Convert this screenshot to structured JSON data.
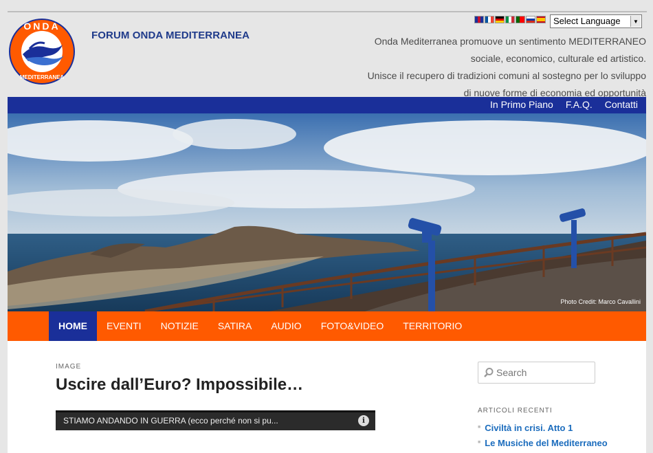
{
  "header": {
    "site_title": "FORUM ONDA MEDITERRANEA",
    "logo_text_top": "ONDA",
    "logo_text_bottom": "MEDITERRANEA",
    "language_select": "Select Language",
    "tagline_lines": [
      "Onda Mediterranea promuove un sentimento MEDITERRANEO",
      "sociale, economico, culturale ed artistico.",
      "Unisce il recupero di tradizioni comuni al sostegno per lo sviluppo",
      "di nuove forme di economia ed opportunità"
    ]
  },
  "top_nav": [
    "In Primo Piano",
    "F.A.Q.",
    "Contatti"
  ],
  "hero": {
    "credit": "Photo Credit: Marco Cavallini"
  },
  "main_nav": [
    "HOME",
    "EVENTI",
    "NOTIZIE",
    "SATIRA",
    "AUDIO",
    "FOTO&VIDEO",
    "TERRITORIO"
  ],
  "post": {
    "format": "IMAGE",
    "title": "Uscire dall’Euro? Impossibile…",
    "video_title": "STIAMO ANDANDO IN GUERRA (ecco perché non si pu..."
  },
  "sidebar": {
    "search_placeholder": "Search",
    "recent_title": "ARTICOLI RECENTI",
    "recent_items": [
      "Civiltà in crisi. Atto 1",
      "Le Musiche del Mediterraneo"
    ]
  },
  "colors": {
    "accent_orange": "#ff5a00",
    "accent_blue": "#1a2f99",
    "link_blue": "#1b6cbd"
  },
  "icons": {
    "search": "search-icon",
    "info": "info-icon",
    "dropdown": "chevron-down-icon"
  }
}
